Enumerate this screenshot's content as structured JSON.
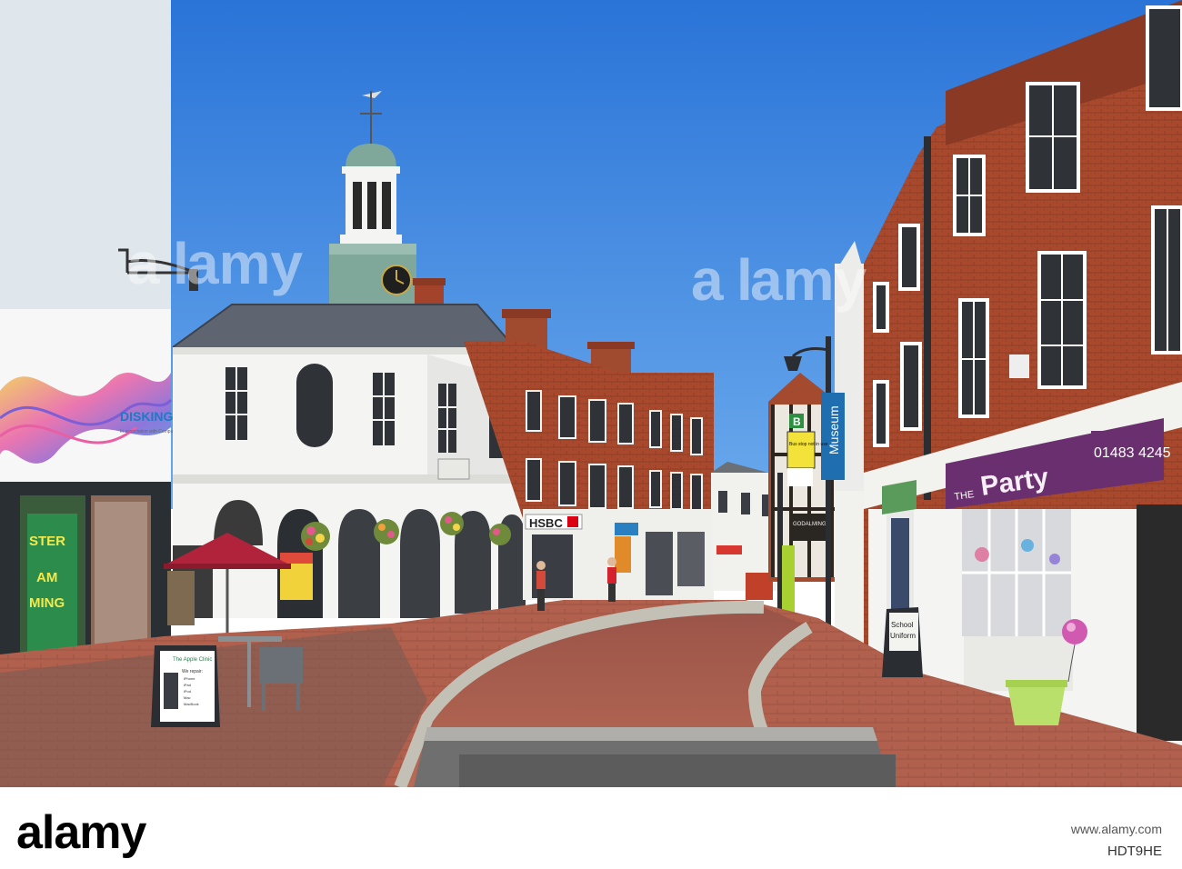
{
  "photo": {
    "watermark": "alamy",
    "signs": {
      "disking_brand": "DISKING",
      "disking_tagline": "In association with Computers Direct",
      "poster_left_1": "STER",
      "poster_left_2": "AM",
      "poster_left_3": "MING",
      "apple_clinic": "The Apple Clinic",
      "apple_clinic_subtitle": "We repair:",
      "apple_clinic_list": [
        "iPhone",
        "iPad",
        "iPod",
        "Mac",
        "MacBook"
      ],
      "hsbc": "HSBC",
      "museum": "Museum",
      "bus_stop_letter": "B",
      "bus_notice": "Bus stop not in use",
      "party_shop": "Party",
      "party_prefix": "THE",
      "party_phone": "01483 4245",
      "school_uniform_1": "School",
      "school_uniform_2": "Uniform",
      "godalming_sign": "GODALMING"
    }
  },
  "footer": {
    "logo": "alamy",
    "image_id": "HDT9HE",
    "url": "www.alamy.com"
  },
  "colors": {
    "sky": "#2f7fe0",
    "brick": "#a44a2f",
    "pavement": "#b5614f",
    "white_building": "#f4f4f2",
    "copper_roof": "#7fa89a"
  }
}
